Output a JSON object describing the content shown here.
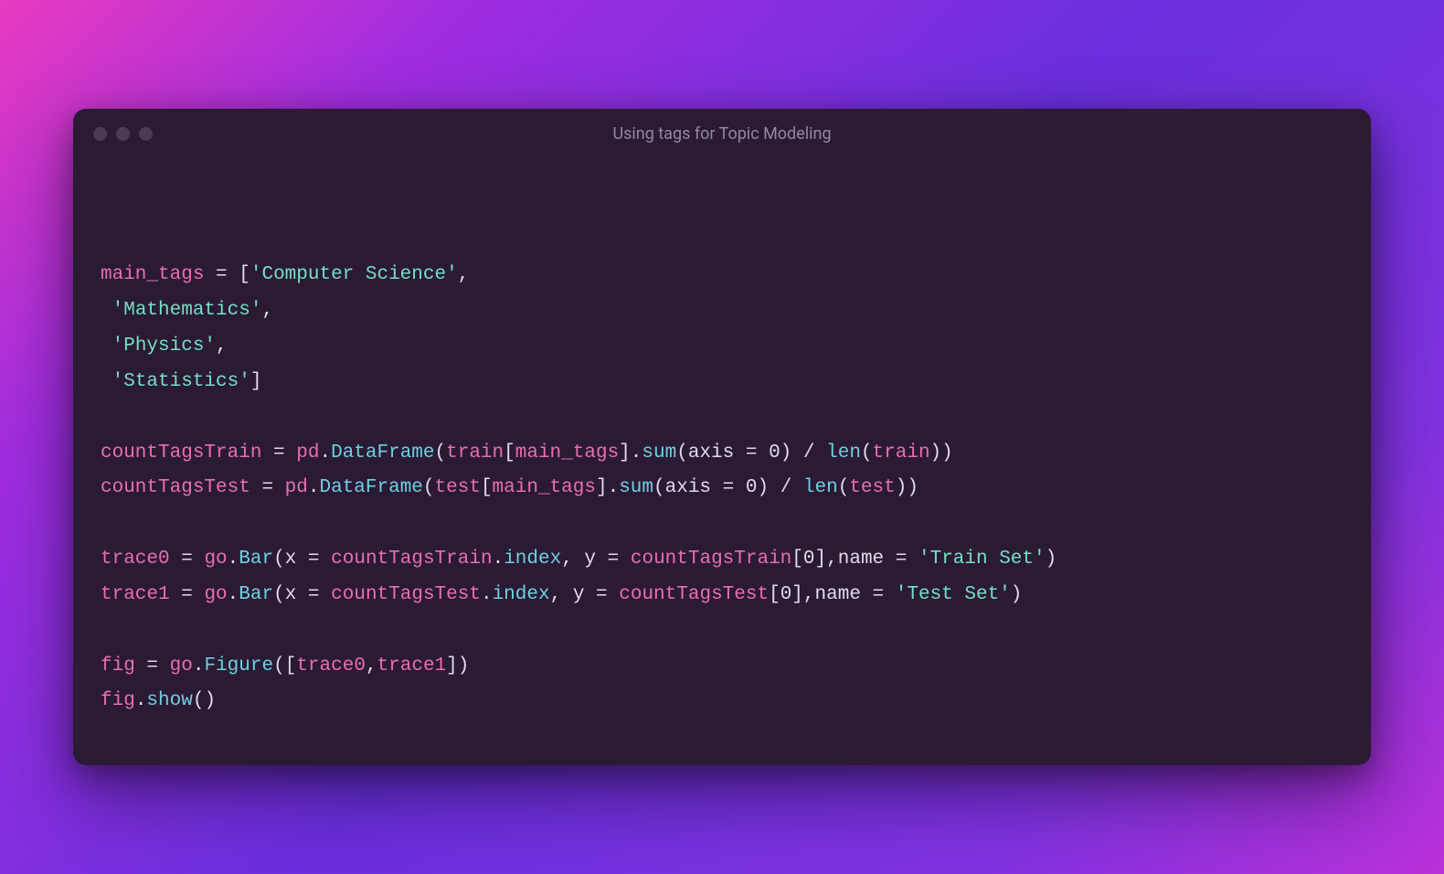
{
  "window": {
    "title": "Using tags for Topic Modeling"
  },
  "code": {
    "main_tags_var": "main_tags",
    "tags": {
      "t0": "'Computer Science'",
      "t1": "'Mathematics'",
      "t2": "'Physics'",
      "t3": "'Statistics'"
    },
    "line_train": {
      "lhs": "countTagsTrain",
      "pd": "pd",
      "df_call": "DataFrame",
      "src": "train",
      "idx": "main_tags",
      "sum": "sum",
      "axis_kw": "axis",
      "axis_val": "0",
      "len": "len",
      "len_arg": "train"
    },
    "line_test": {
      "lhs": "countTagsTest",
      "pd": "pd",
      "df_call": "DataFrame",
      "src": "test",
      "idx": "main_tags",
      "sum": "sum",
      "axis_kw": "axis",
      "axis_val": "0",
      "len": "len",
      "len_arg": "test"
    },
    "trace0": {
      "lhs": "trace0",
      "go": "go",
      "bar": "Bar",
      "x_kw": "x",
      "x_src": "countTagsTrain",
      "index": "index",
      "y_kw": "y",
      "y_src": "countTagsTrain",
      "y_idx": "0",
      "name_kw": "name",
      "name_val": "'Train Set'"
    },
    "trace1": {
      "lhs": "trace1",
      "go": "go",
      "bar": "Bar",
      "x_kw": "x",
      "x_src": "countTagsTest",
      "index": "index",
      "y_kw": "y",
      "y_src": "countTagsTest",
      "y_idx": "0",
      "name_kw": "name",
      "name_val": "'Test Set'"
    },
    "fig": {
      "lhs": "fig",
      "go": "go",
      "figure": "Figure",
      "arg0": "trace0",
      "arg1": "trace1"
    },
    "fig_show": {
      "obj": "fig",
      "method": "show"
    }
  }
}
